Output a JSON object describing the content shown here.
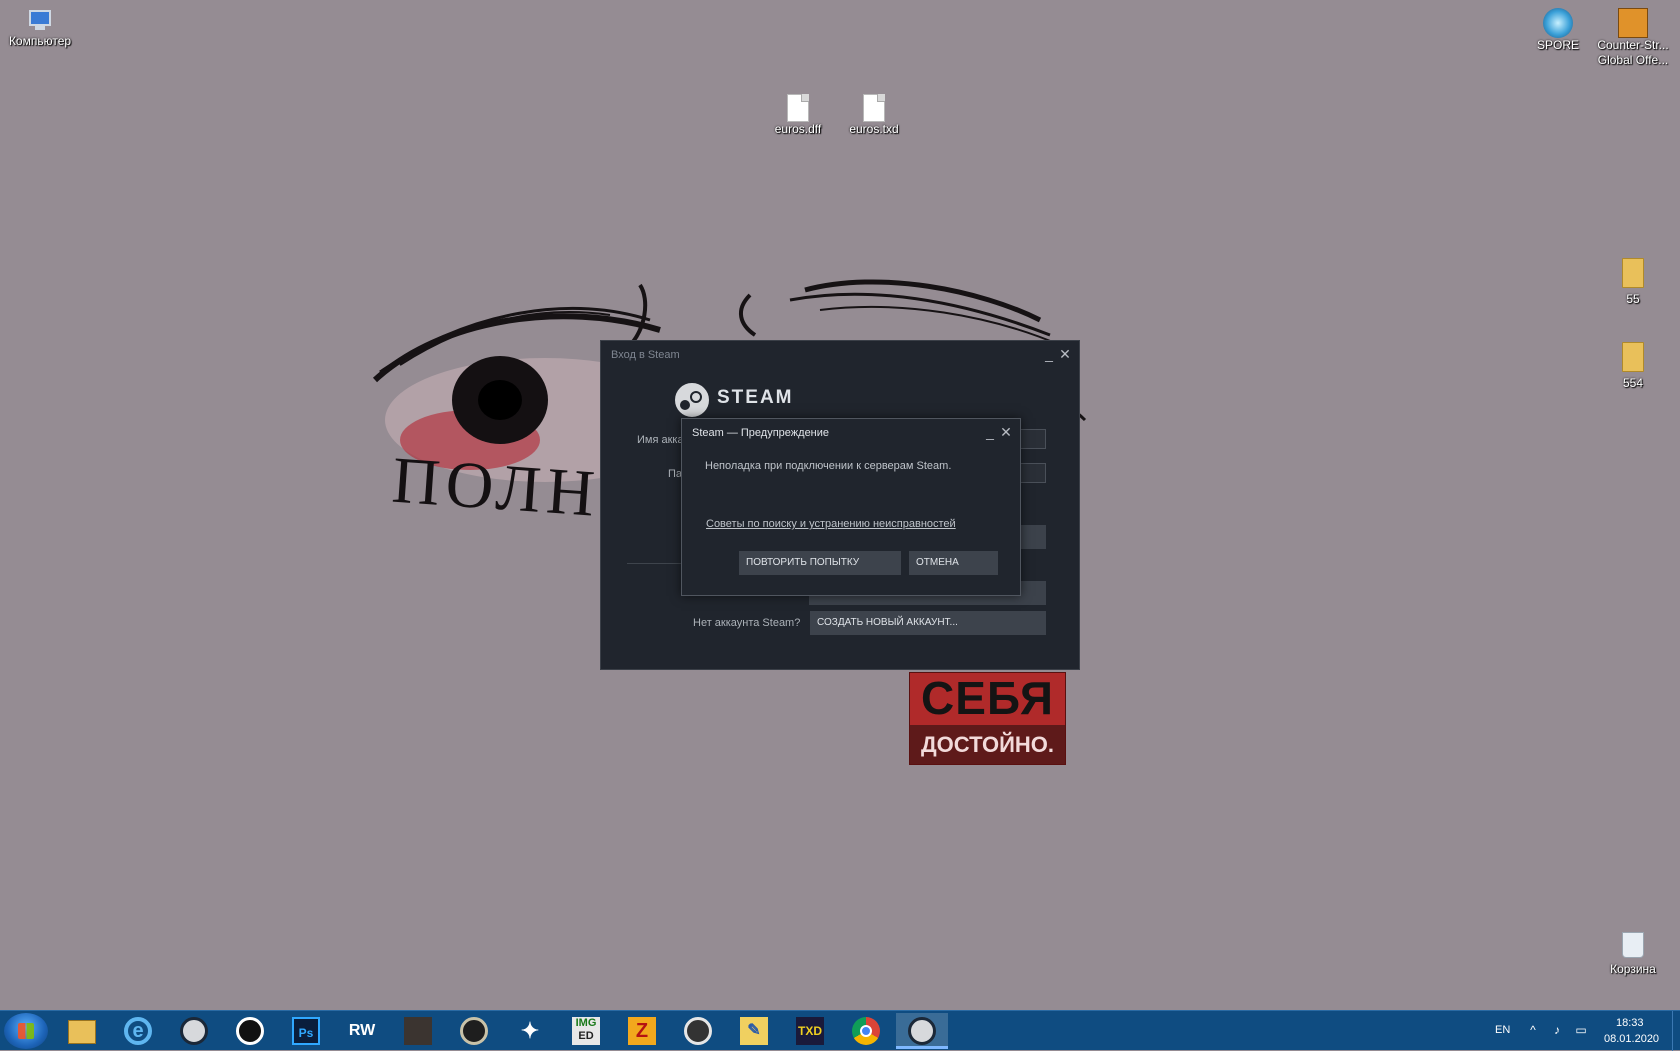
{
  "desktop": {
    "icons": {
      "computer": "Компьютер",
      "euros_dff": "euros.dff",
      "euros_txd": "euros.txd",
      "spore": "SPORE",
      "csgo_line1": "Counter-Str...",
      "csgo_line2": "Global Offe...",
      "folder_55": "55",
      "folder_554": "554",
      "recycle_bin": "Корзина"
    },
    "wallpaper": {
      "handwritten_text": "ПОЛНЫ",
      "poster_line1": "СЕБЯ",
      "poster_line2": "ДОСТОЙНО."
    }
  },
  "login_window": {
    "title": "Вход в Steam",
    "brand": "STEAM",
    "account_label": "Имя акка",
    "password_label": "Па",
    "no_account_label": "Нет аккаунта Steam?",
    "create_account_button": "СОЗДАТЬ НОВЫЙ АККАУНТ..."
  },
  "warning_dialog": {
    "title": "Steam — Предупреждение",
    "message": "Неполадка при подключении к серверам Steam.",
    "help_link": "Советы по поиску и устранению неисправностей",
    "retry_button": "ПОВТОРИТЬ ПОПЫТКУ",
    "cancel_button": "ОТМЕНА"
  },
  "window_controls": {
    "minimize": "_",
    "close": "✕"
  },
  "taskbar": {
    "pinned": [
      "file-explorer",
      "internet-explorer",
      "steam",
      "recorder",
      "photoshop",
      "rw-analyzer",
      "game-character",
      "cs-go",
      "editor",
      "img-tool",
      "zmodeler",
      "spore-tool",
      "editor-pen",
      "txd-workshop",
      "chrome",
      "steam-running"
    ],
    "labels": {
      "photoshop": "Ps",
      "rw": "RW",
      "img_top": "IMG",
      "img_bottom": "ED",
      "z": "Z",
      "txd": "TXD"
    },
    "language": "EN",
    "time": "18:33",
    "date": "08.01.2020",
    "colors": {
      "bar": "#0f4c81",
      "active": "#7fb8ff"
    }
  }
}
